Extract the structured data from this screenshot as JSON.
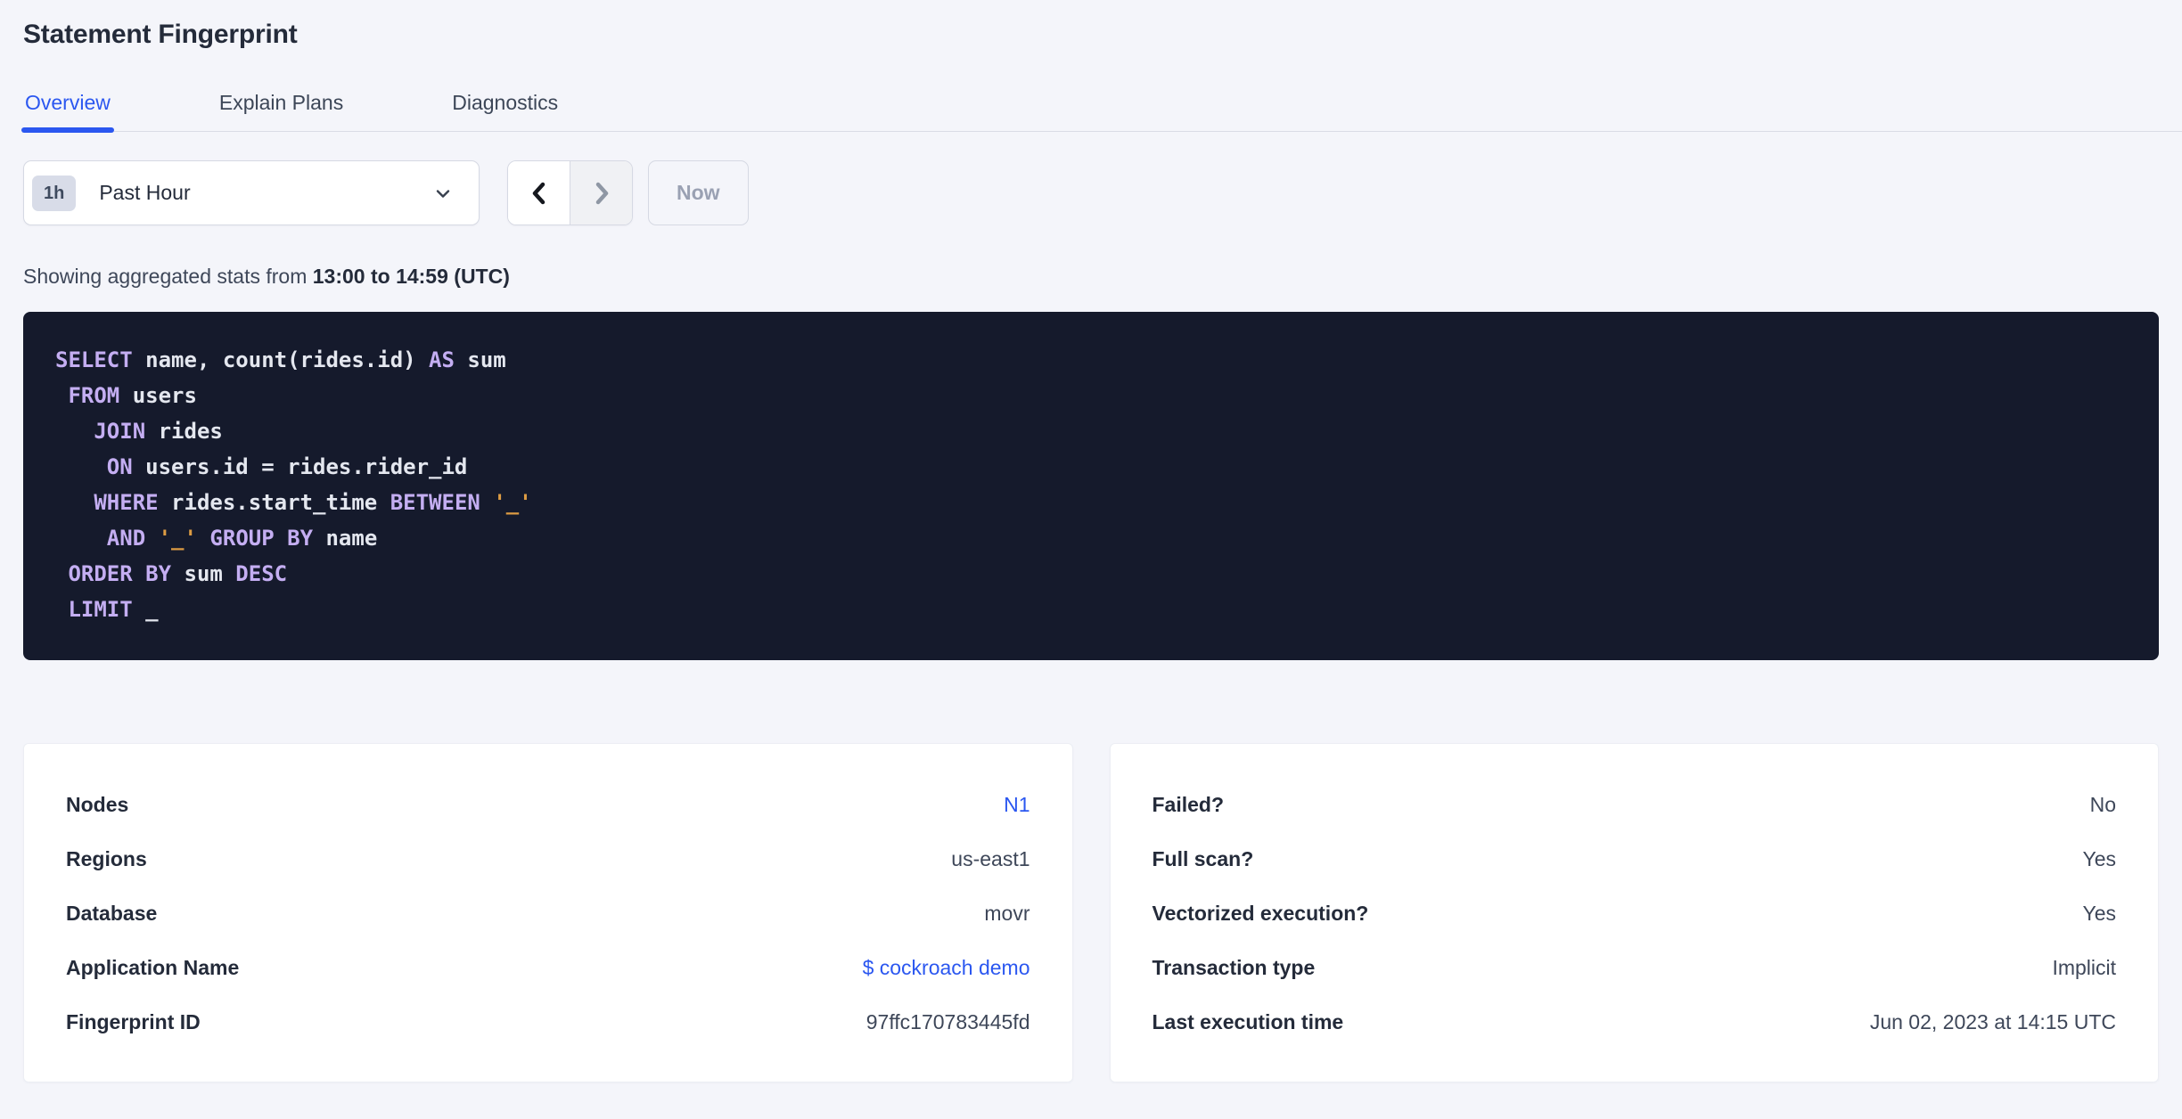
{
  "page": {
    "title": "Statement Fingerprint"
  },
  "colors": {
    "accent": "#2b57f0",
    "page-bg": "#f4f5fa",
    "heading": "#242b3a",
    "muted": "#3e4759",
    "disabled": "#9aa1b3",
    "border": "#d6d9e3",
    "sql-bg": "#151a2c",
    "kw": "#c4aef2",
    "plain": "#e4e7ef",
    "str": "#dd9c43"
  },
  "tabs": [
    {
      "label": "Overview",
      "active": true
    },
    {
      "label": "Explain Plans",
      "active": false
    },
    {
      "label": "Diagnostics",
      "active": false
    }
  ],
  "time_picker": {
    "interval_badge": "1h",
    "selected": "Past Hour",
    "now_label": "Now",
    "icons": {
      "open": "chevron-down-icon",
      "prev": "chevron-left-icon",
      "next": "chevron-right-icon"
    }
  },
  "stats_line": {
    "prefix": "Showing aggregated stats from ",
    "bold_range": "13:00 to 14:59 (UTC)"
  },
  "sql": {
    "lines": [
      [
        {
          "t": "SELECT",
          "c": "kw"
        },
        {
          "t": " name, count(rides.id) ",
          "c": "pl"
        },
        {
          "t": "AS",
          "c": "kw"
        },
        {
          "t": " sum",
          "c": "pl"
        }
      ],
      [
        {
          "t": " ",
          "c": "pl"
        },
        {
          "t": "FROM",
          "c": "kw"
        },
        {
          "t": " users",
          "c": "pl"
        }
      ],
      [
        {
          "t": "   ",
          "c": "pl"
        },
        {
          "t": "JOIN",
          "c": "kw"
        },
        {
          "t": " rides",
          "c": "pl"
        }
      ],
      [
        {
          "t": "    ",
          "c": "pl"
        },
        {
          "t": "ON",
          "c": "kw"
        },
        {
          "t": " users.id = rides.rider_id",
          "c": "pl"
        }
      ],
      [
        {
          "t": "   ",
          "c": "pl"
        },
        {
          "t": "WHERE",
          "c": "kw"
        },
        {
          "t": " rides.start_time ",
          "c": "pl"
        },
        {
          "t": "BETWEEN",
          "c": "kw"
        },
        {
          "t": " ",
          "c": "pl"
        },
        {
          "t": "'_'",
          "c": "str"
        }
      ],
      [
        {
          "t": "    ",
          "c": "pl"
        },
        {
          "t": "AND",
          "c": "kw"
        },
        {
          "t": " ",
          "c": "pl"
        },
        {
          "t": "'_'",
          "c": "str"
        },
        {
          "t": " ",
          "c": "pl"
        },
        {
          "t": "GROUP BY",
          "c": "kw"
        },
        {
          "t": " name",
          "c": "pl"
        }
      ],
      [
        {
          "t": " ",
          "c": "pl"
        },
        {
          "t": "ORDER BY",
          "c": "kw"
        },
        {
          "t": " sum ",
          "c": "pl"
        },
        {
          "t": "DESC",
          "c": "kw"
        }
      ],
      [
        {
          "t": " ",
          "c": "pl"
        },
        {
          "t": "LIMIT",
          "c": "kw"
        },
        {
          "t": " _",
          "c": "pl"
        }
      ]
    ]
  },
  "cards": {
    "left": {
      "rows": [
        {
          "label": "Nodes",
          "value": "N1",
          "link": true
        },
        {
          "label": "Regions",
          "value": "us-east1",
          "link": false
        },
        {
          "label": "Database",
          "value": "movr",
          "link": false
        },
        {
          "label": "Application Name",
          "value": "$ cockroach demo",
          "link": true
        },
        {
          "label": "Fingerprint ID",
          "value": "97ffc170783445fd",
          "link": false
        }
      ]
    },
    "right": {
      "rows": [
        {
          "label": "Failed?",
          "value": "No",
          "link": false
        },
        {
          "label": "Full scan?",
          "value": "Yes",
          "link": false
        },
        {
          "label": "Vectorized execution?",
          "value": "Yes",
          "link": false
        },
        {
          "label": "Transaction type",
          "value": "Implicit",
          "link": false
        },
        {
          "label": "Last execution time",
          "value": "Jun 02, 2023 at 14:15 UTC",
          "link": false
        }
      ]
    }
  }
}
